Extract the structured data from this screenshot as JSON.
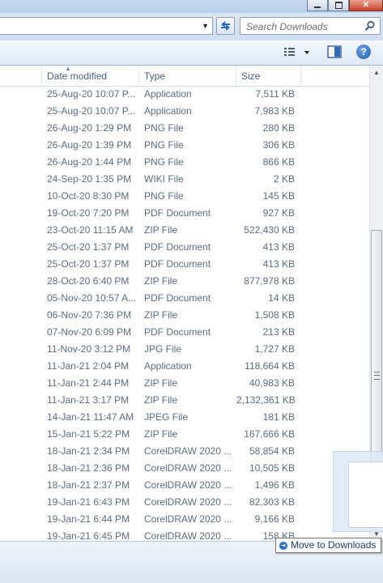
{
  "search": {
    "placeholder": "Search Downloads"
  },
  "columns": {
    "date": "Date modified",
    "type": "Type",
    "size": "Size"
  },
  "rows": [
    {
      "date": "25-Aug-20 10:07 P...",
      "type": "Application",
      "size": "7,511 KB"
    },
    {
      "date": "25-Aug-20 10:07 P...",
      "type": "Application",
      "size": "7,983 KB"
    },
    {
      "date": "26-Aug-20 1:29 PM",
      "type": "PNG File",
      "size": "280 KB"
    },
    {
      "date": "26-Aug-20 1:39 PM",
      "type": "PNG File",
      "size": "306 KB"
    },
    {
      "date": "26-Aug-20 1:44 PM",
      "type": "PNG File",
      "size": "866 KB"
    },
    {
      "date": "24-Sep-20 1:35 PM",
      "type": "WIKI File",
      "size": "2 KB"
    },
    {
      "date": "10-Oct-20 8:30 PM",
      "type": "PNG File",
      "size": "145 KB"
    },
    {
      "date": "19-Oct-20 7:20 PM",
      "type": "PDF Document",
      "size": "927 KB"
    },
    {
      "date": "23-Oct-20 11:15 AM",
      "type": "ZIP File",
      "size": "522,430 KB"
    },
    {
      "date": "25-Oct-20 1:37 PM",
      "type": "PDF Document",
      "size": "413 KB"
    },
    {
      "date": "25-Oct-20 1:37 PM",
      "type": "PDF Document",
      "size": "413 KB"
    },
    {
      "date": "28-Oct-20 6:40 PM",
      "type": "ZIP File",
      "size": "877,978 KB"
    },
    {
      "date": "05-Nov-20 10:57 A...",
      "type": "PDF Document",
      "size": "14 KB"
    },
    {
      "date": "06-Nov-20 7:36 PM",
      "type": "ZIP File",
      "size": "1,508 KB"
    },
    {
      "date": "07-Nov-20 6:09 PM",
      "type": "PDF Document",
      "size": "213 KB"
    },
    {
      "date": "11-Nov-20 3:12 PM",
      "type": "JPG File",
      "size": "1,727 KB"
    },
    {
      "date": "11-Jan-21 2:04 PM",
      "type": "Application",
      "size": "118,664 KB"
    },
    {
      "date": "11-Jan-21 2:44 PM",
      "type": "ZIP File",
      "size": "40,983 KB"
    },
    {
      "date": "11-Jan-21 3:17 PM",
      "type": "ZIP File",
      "size": "2,132,361 KB"
    },
    {
      "date": "14-Jan-21 11:47 AM",
      "type": "JPEG File",
      "size": "181 KB"
    },
    {
      "date": "15-Jan-21 5:22 PM",
      "type": "ZIP File",
      "size": "167,666 KB"
    },
    {
      "date": "18-Jan-21 2:34 PM",
      "type": "CorelDRAW 2020 ...",
      "size": "58,854 KB"
    },
    {
      "date": "18-Jan-21 2:36 PM",
      "type": "CorelDRAW 2020 ...",
      "size": "10,505 KB"
    },
    {
      "date": "18-Jan-21 2:37 PM",
      "type": "CorelDRAW 2020 ...",
      "size": "1,496 KB"
    },
    {
      "date": "19-Jan-21 6:43 PM",
      "type": "CorelDRAW 2020 ...",
      "size": "82,303 KB"
    },
    {
      "date": "19-Jan-21 6:44 PM",
      "type": "CorelDRAW 2020 ...",
      "size": "9,166 KB"
    },
    {
      "date": "19-Jan-21 6:45 PM",
      "type": "CorelDRAW 2020 ...",
      "size": "158 KB"
    }
  ],
  "tooltip": {
    "label": "Move to Downloads"
  },
  "icons": {
    "search": "search-icon",
    "refresh": "refresh-icon",
    "views": "views-icon",
    "preview": "preview-pane-icon",
    "help": "help-icon"
  },
  "colors": {
    "accent": "#1f5fb5",
    "text": "#5b6b7f"
  }
}
